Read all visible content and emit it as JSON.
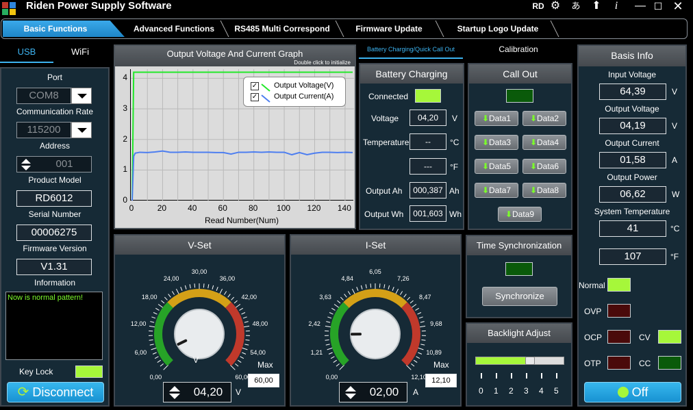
{
  "app": {
    "title": "Riden Power Supply Software",
    "user_badge": "RD"
  },
  "tabs": [
    "Basic Functions",
    "Advanced Functions",
    "RS485 Multi Correspond",
    "Firmware Update",
    "Startup Logo Update"
  ],
  "connection": {
    "tabs": [
      "USB",
      "WiFi"
    ],
    "port_label": "Port",
    "port_value": "COM8",
    "rate_label": "Communication Rate",
    "rate_value": "115200",
    "address_label": "Address",
    "address_value": "001",
    "model_label": "Product Model",
    "model_value": "RD6012",
    "serial_label": "Serial Number",
    "serial_value": "00006275",
    "firmware_label": "Firmware Version",
    "firmware_value": "V1.31",
    "info_label": "Information",
    "info_text": "Now is normal pattern!",
    "keylock_label": "Key Lock",
    "disconnect_label": "Disconnect"
  },
  "graph": {
    "title": "Output Voltage And Current Graph",
    "hint": "Double click to initialize",
    "legend_voltage": "Output Voltage(V)",
    "legend_current": "Output Current(A)",
    "xlabel": "Read Number(Num)",
    "y_ticks": [
      "4",
      "3",
      "2",
      "1",
      "0"
    ],
    "x_ticks": [
      "0",
      "20",
      "40",
      "60",
      "80",
      "100",
      "120",
      "140"
    ],
    "colors": {
      "voltage": "#22e82a",
      "current": "#4d7ef0"
    }
  },
  "chart_data": {
    "type": "line",
    "xlabel": "Read Number(Num)",
    "ylabel": "",
    "xlim": [
      0,
      145
    ],
    "ylim": [
      0,
      4.3
    ],
    "series": [
      {
        "name": "Output Voltage(V)",
        "x": [
          0,
          1,
          2,
          145
        ],
        "values": [
          0.0,
          4.2,
          4.2,
          4.2
        ]
      },
      {
        "name": "Output Current(A)",
        "x": [
          0,
          1,
          2,
          5,
          10,
          15,
          20,
          25,
          30,
          35,
          40,
          45,
          50,
          55,
          60,
          65,
          70,
          75,
          80,
          85,
          90,
          95,
          100,
          105,
          110,
          115,
          120,
          125,
          130,
          135,
          140,
          145
        ],
        "values": [
          0.0,
          1.45,
          1.55,
          1.58,
          1.57,
          1.59,
          1.62,
          1.58,
          1.58,
          1.59,
          1.58,
          1.58,
          1.58,
          1.57,
          1.57,
          1.52,
          1.58,
          1.58,
          1.59,
          1.58,
          1.59,
          1.58,
          1.58,
          1.5,
          1.57,
          1.5,
          1.55,
          1.58,
          1.58,
          1.57,
          1.58,
          1.57
        ]
      }
    ]
  },
  "battery": {
    "tab_label": "Battery Charging/Quick Call Out",
    "calibration_label": "Calibration",
    "title": "Battery Charging",
    "connected_label": "Connected",
    "voltage_label": "Voltage",
    "voltage_value": "04,20",
    "voltage_unit": "V",
    "temp_label": "Temperature",
    "temp_c_value": "--",
    "temp_c_unit": "°C",
    "temp_f_value": "---",
    "temp_f_unit": "°F",
    "ah_label": "Output Ah",
    "ah_value": "000,387",
    "ah_unit": "Ah",
    "wh_label": "Output Wh",
    "wh_value": "001,603",
    "wh_unit": "Wh"
  },
  "callout": {
    "title": "Call Out",
    "buttons": [
      "Data1",
      "Data2",
      "Data3",
      "Data4",
      "Data5",
      "Data6",
      "Data7",
      "Data8",
      "Data9"
    ]
  },
  "timesync": {
    "title": "Time Synchronization",
    "button": "Synchronize"
  },
  "backlight": {
    "title": "Backlight Adjust",
    "ticks": [
      "0",
      "1",
      "2",
      "3",
      "4",
      "5"
    ],
    "level_fraction": 0.62
  },
  "vset": {
    "title": "V-Set",
    "scale": [
      "0,00",
      "6,00",
      "12,00",
      "18,00",
      "24,00",
      "30,00",
      "36,00",
      "42,00",
      "48,00",
      "54,00",
      "60,00"
    ],
    "unit": "V",
    "max_label": "Max",
    "max_value": "60,00",
    "value": "04,20",
    "value_unit": "V",
    "value_num": 4.2,
    "max_num": 60
  },
  "iset": {
    "title": "I-Set",
    "scale": [
      "0,00",
      "1,21",
      "2,42",
      "3,63",
      "4,84",
      "6,05",
      "7,26",
      "8,47",
      "9,68",
      "10,89",
      "12,10"
    ],
    "unit": "A",
    "max_label": "Max",
    "max_value": "12,10",
    "value": "02,00",
    "value_unit": "A",
    "value_num": 2.0,
    "max_num": 12.1
  },
  "basis": {
    "title": "Basis Info",
    "input_voltage_label": "Input Voltage",
    "input_voltage": "64,39",
    "input_voltage_unit": "V",
    "output_voltage_label": "Output Voltage",
    "output_voltage": "04,19",
    "output_voltage_unit": "V",
    "output_current_label": "Output Current",
    "output_current": "01,58",
    "output_current_unit": "A",
    "output_power_label": "Output Power",
    "output_power": "06,62",
    "output_power_unit": "W",
    "sys_temp_label": "System Temperature",
    "sys_temp_c": "41",
    "sys_temp_c_unit": "°C",
    "sys_temp_f": "107",
    "sys_temp_f_unit": "°F",
    "normal_label": "Normal",
    "ovp_label": "OVP",
    "ocp_label": "OCP",
    "otp_label": "OTP",
    "cv_label": "CV",
    "cc_label": "CC",
    "off_label": "Off"
  }
}
